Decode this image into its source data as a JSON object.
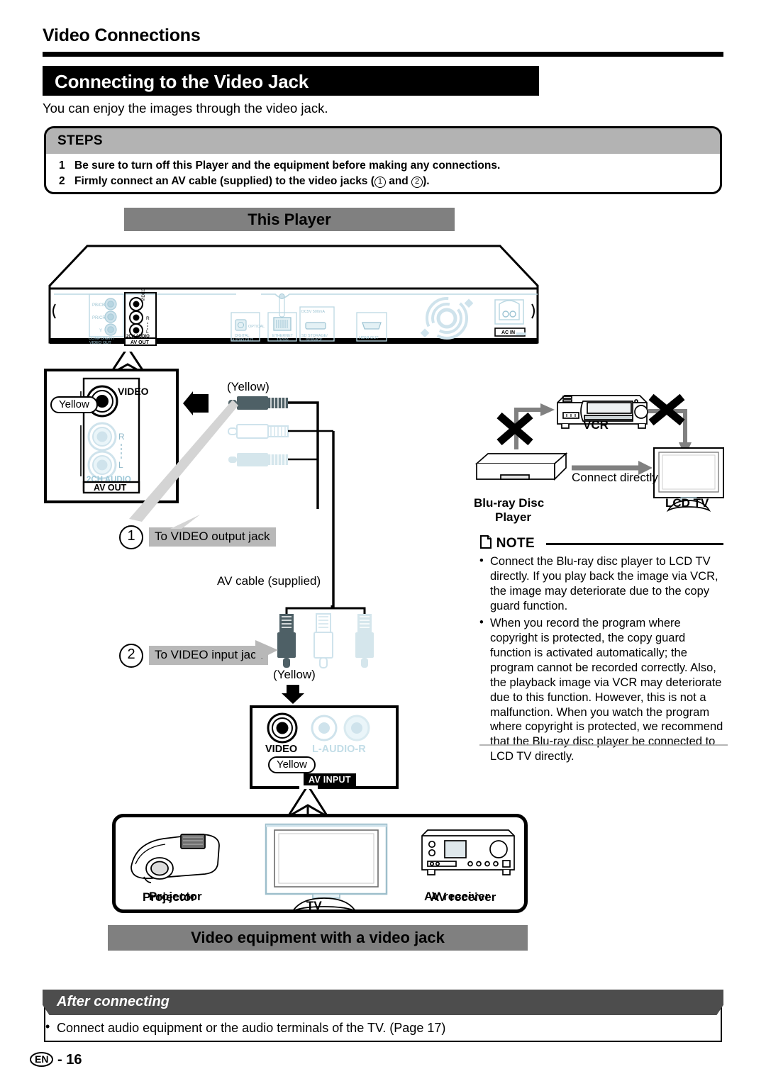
{
  "section_title": "Video Connections",
  "page_title": "Connecting to the Video Jack",
  "intro": "You can enjoy the images through the video jack.",
  "steps": {
    "heading": "STEPS",
    "items": [
      {
        "num": "1",
        "text": "Be sure to turn off this Player and the equipment before making any connections."
      },
      {
        "num": "2a",
        "text": "Firmly connect an AV cable (supplied) to the video jacks ("
      },
      {
        "num": "2b",
        "text": " and "
      },
      {
        "num": "2c",
        "text": ")."
      }
    ],
    "item1_num": "1",
    "item2_num": "2",
    "item2_pre": "Firmly connect an AV cable (supplied) to the video jacks (",
    "item2_mid": "and",
    "item2_post": ").",
    "circ1": "1",
    "circ2": "2"
  },
  "this_player_banner": "This Player",
  "video_equipment_banner": "Video equipment with a video jack",
  "rear_panel": {
    "component_video_out": "COMPONENT VIDEO OUT",
    "pb_cb": "PB/CB",
    "pr_cr": "PR/CR",
    "y": "Y",
    "video": "VIDEO",
    "r": "R",
    "l": "L",
    "two_ch_audio": "2CH AUDIO",
    "av_out": "AV OUT",
    "optical": "OPTICAL",
    "digital_audio_out": "DIGITAL AUDIO OUT",
    "ethernet": "ETHERNET 10/100",
    "dc5v": "DC5V 500mA",
    "sd_storage": "SD STORAGE/ SERVICE",
    "hdmi_out": "HDMI OUT",
    "ac_in": "AC IN"
  },
  "av_out_callout": {
    "yellow": "Yellow",
    "video": "VIDEO",
    "r": "R",
    "l": "L",
    "two_ch_audio": "2CH AUDIO",
    "av_out": "AV OUT"
  },
  "cable": {
    "yellow_top": "(Yellow)",
    "yellow_bottom": "(Yellow)",
    "supplied_label": "AV cable (supplied)",
    "step1_num": "1",
    "step1_label": "To VIDEO output jack",
    "step2_num": "2",
    "step2_label": "To VIDEO input jack"
  },
  "av_input_callout": {
    "video": "VIDEO",
    "l_audio_r": "L-AUDIO-R",
    "yellow": "Yellow",
    "av_input": "AV INPUT"
  },
  "equipment": [
    {
      "name": "projector",
      "label": "Projector"
    },
    {
      "name": "tv",
      "label": "TV"
    },
    {
      "name": "av-receiver",
      "label": "AV receiver"
    }
  ],
  "vcr_diagram": {
    "vcr": "VCR",
    "bluray_line1": "Blu-ray Disc",
    "bluray_line2": "Player",
    "lcd_tv": "LCD TV",
    "connect_directly": "Connect directly"
  },
  "note": {
    "heading": "NOTE",
    "bullets": [
      "Connect the Blu-ray disc player to LCD TV directly. If you play back the image via VCR, the image may deteriorate due to the copy guard function.",
      "When you record the program where copyright is protected, the copy guard function is activated automatically; the program cannot be recorded correctly. Also, the playback image via VCR may deteriorate due to this function. However, this is not a malfunction. When you watch the program where copyright is protected, we recommend that the Blu-ray disc player be connected to LCD TV directly."
    ]
  },
  "after_connecting": {
    "heading": "After connecting",
    "bullet": "Connect audio equipment or the audio terminals of the TV. (Page 17)"
  },
  "footer": {
    "lang": "EN",
    "sep": "-",
    "page": "16"
  },
  "colors": {
    "banner_grey": "#808080",
    "steps_grey": "#b3b3b3",
    "tag_grey": "#b8b8b8",
    "after_grey": "#4d4d4d",
    "black": "#000000",
    "panel_blue": "#cfe0e8"
  }
}
